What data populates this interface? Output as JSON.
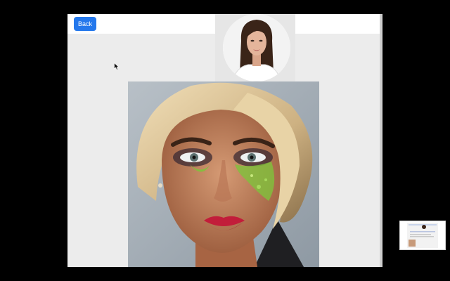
{
  "header": {
    "back_label": "Back"
  },
  "icons": {
    "cursor": "arrow-cursor-icon"
  },
  "colors": {
    "page_background": "#000000",
    "window_background": "#ececec",
    "header_background": "#ffffff",
    "accent": "#2478ec",
    "lip_color": "#c21d3a",
    "glitter_color": "#7fc23c"
  }
}
